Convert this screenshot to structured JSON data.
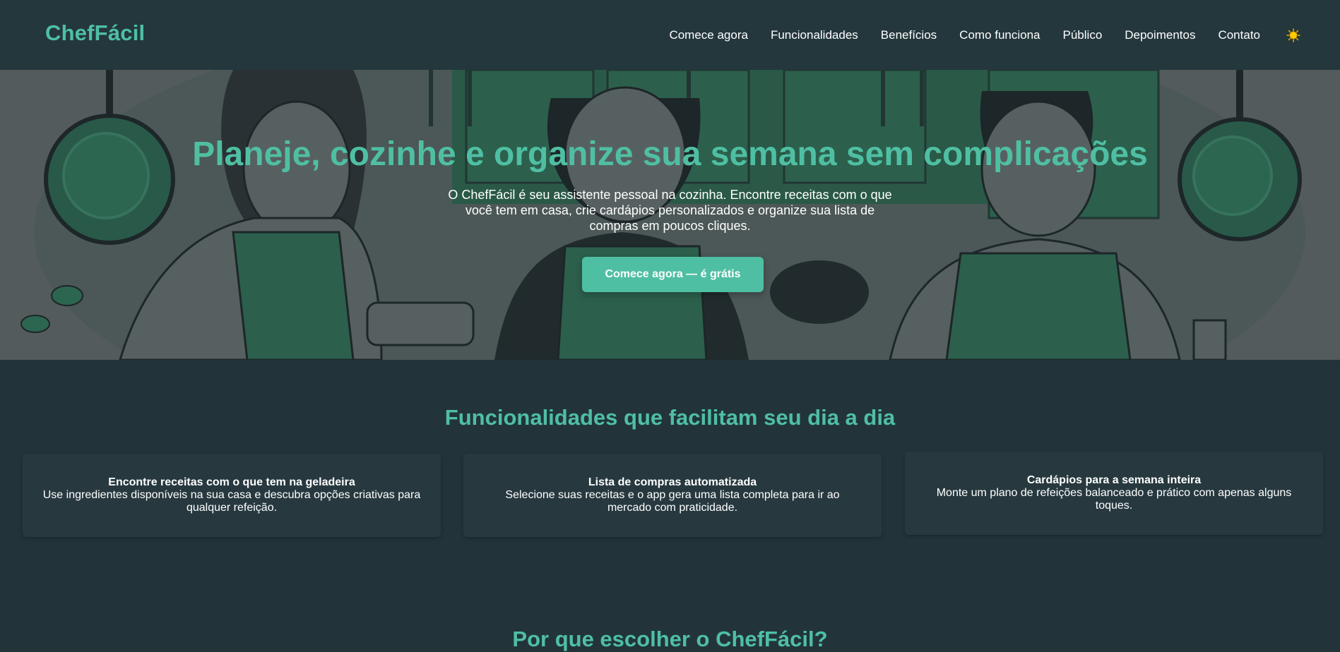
{
  "brand": {
    "logo": "ChefFácil",
    "accent_color": "#4fbfa3",
    "background_color": "#22343a"
  },
  "nav": {
    "items": [
      {
        "label": "Comece agora"
      },
      {
        "label": "Funcionalidades"
      },
      {
        "label": "Benefícios"
      },
      {
        "label": "Como funciona"
      },
      {
        "label": "Público"
      },
      {
        "label": "Depoimentos"
      },
      {
        "label": "Contato"
      }
    ],
    "theme_toggle_icon": "sun-icon"
  },
  "hero": {
    "title": "Planeje, cozinhe e organize sua semana sem complicações",
    "subtitle": "O ChefFácil é seu assistente pessoal na cozinha. Encontre receitas com o que você tem em casa, crie cardápios personalizados e organize sua lista de compras em poucos cliques.",
    "cta_label": "Comece agora — é grátis",
    "illustration": "three-cooks-in-kitchen-illustration"
  },
  "features": {
    "title": "Funcionalidades que facilitam seu dia a dia",
    "cards": [
      {
        "title": "Encontre receitas com o que tem na geladeira",
        "text": "Use ingredientes disponíveis na sua casa e descubra opções criativas para qualquer refeição."
      },
      {
        "title": "Lista de compras automatizada",
        "text": "Selecione suas receitas e o app gera uma lista completa para ir ao mercado com praticidade."
      },
      {
        "title": "Cardápios para a semana inteira",
        "text": "Monte um plano de refeições balanceado e prático com apenas alguns toques."
      }
    ]
  },
  "next_section": {
    "title": "Por que escolher o ChefFácil?"
  }
}
